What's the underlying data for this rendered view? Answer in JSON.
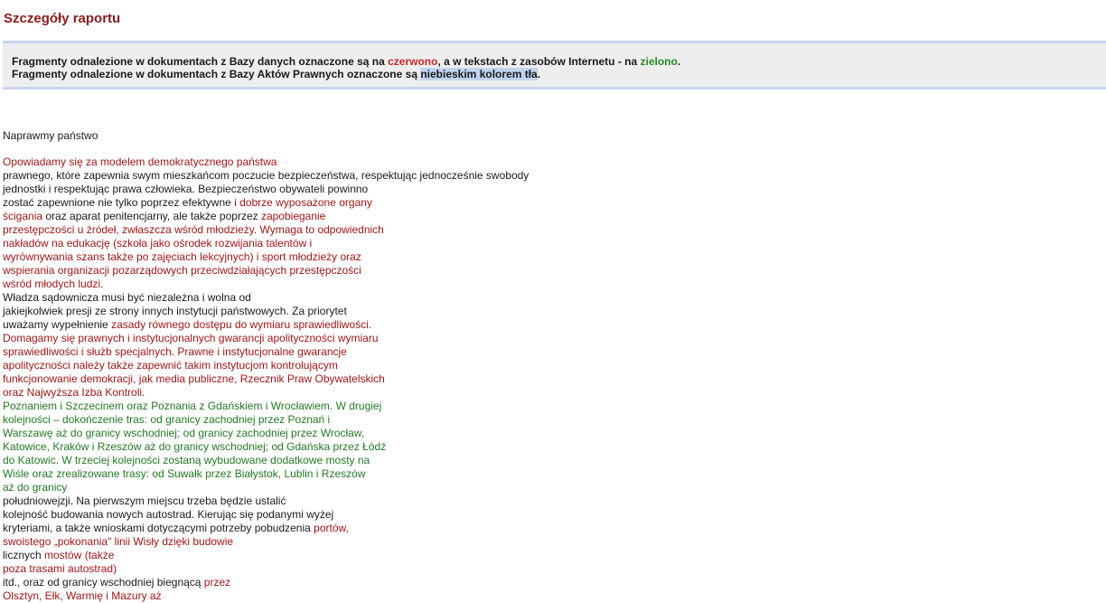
{
  "page": {
    "title": "Szczegóły raportu"
  },
  "legend": {
    "line1": {
      "pre": "Fragmenty odnalezione w dokumentach z Bazy danych oznaczone są na ",
      "red_word": "czerwono",
      "mid": ", a w tekstach z zasobów Internetu - na ",
      "green_word": "zielono",
      "post": "."
    },
    "line2": {
      "pre": "Fragmenty odnalezione w dokumentach z Bazy Aktów Prawnych oznaczone są ",
      "blue_word": "niebieskim kolorem tła",
      "post": "."
    }
  },
  "colors": {
    "title": "#8b1a1a",
    "red_match": "#a01616",
    "green_match": "#237a23",
    "blue_match_bg": "#c2d3ef",
    "legend_bg": "#eeeeee",
    "legend_border": "#c7d3f2"
  },
  "document": {
    "title": "Naprawmy państwo",
    "lines": [
      [
        {
          "t": "Opowiadamy się za modelem demokratycznego państwa",
          "c": "red"
        }
      ],
      [
        {
          "t": "prawnego, które zapewnia swym mieszkańcom poczucie bezpieczeństwa, respektując jednocześnie swobody",
          "c": "plain"
        }
      ],
      [
        {
          "t": "jednostki i respektując prawa człowieka. Bezpieczeństwo obywateli powinno",
          "c": "plain"
        }
      ],
      [
        {
          "t": "zostać zapewnione nie tylko poprzez efektywne ",
          "c": "plain"
        },
        {
          "t": "i dobrze wyposażone organy",
          "c": "red"
        }
      ],
      [
        {
          "t": "ścigania",
          "c": "red"
        },
        {
          "t": " oraz aparat penitencjarny, ale także poprzez ",
          "c": "plain"
        },
        {
          "t": "zapobieganie",
          "c": "red"
        }
      ],
      [
        {
          "t": "przestępczości u źródeł, zwłaszcza wśród młodzieży. Wymaga to odpowiednich",
          "c": "red"
        }
      ],
      [
        {
          "t": "nakładów na edukację (szkoła jako ośrodek rozwijania talentów i",
          "c": "red"
        }
      ],
      [
        {
          "t": "wyrównywania szans także po zajęciach lekcyjnych) i sport młodzieży oraz",
          "c": "red"
        }
      ],
      [
        {
          "t": "wspierania organizacji pozarządowych przeciwdziałających przestępczości",
          "c": "red"
        }
      ],
      [
        {
          "t": "wśród młodych ludzi.",
          "c": "red"
        }
      ],
      [
        {
          "t": "Władza sądownicza musi być niezależna i wolna od",
          "c": "plain"
        }
      ],
      [
        {
          "t": "jakiejkolwiek presji ze strony innych instytucji państwowych. Za priorytet",
          "c": "plain"
        }
      ],
      [
        {
          "t": "uważamy wypełnienie ",
          "c": "plain"
        },
        {
          "t": "zasady równego dostępu do wymiaru sprawiedliwości.",
          "c": "red"
        }
      ],
      [
        {
          "t": "Domagamy się prawnych i instytucjonalnych gwarancji apolityczności wymiaru",
          "c": "red"
        }
      ],
      [
        {
          "t": "sprawiedliwości i służb specjalnych. Prawne i instytucjonalne gwarancje",
          "c": "red"
        }
      ],
      [
        {
          "t": "apolityczności należy także zapewnić takim instytucjom kontrolującym",
          "c": "red"
        }
      ],
      [
        {
          "t": "funkcjonowanie demokracji, jak media publiczne, Rzecznik Praw Obywatelskich",
          "c": "red"
        }
      ],
      [
        {
          "t": "oraz Najwyższa Izba Kontroli.",
          "c": "red"
        }
      ],
      [
        {
          "t": "Poznaniem i Szczecinem oraz Poznania z Gdańskiem i Wrocławiem. W drugiej",
          "c": "green"
        }
      ],
      [
        {
          "t": "kolejności – dokończenie tras: od granicy zachodniej przez Poznań i",
          "c": "green"
        }
      ],
      [
        {
          "t": "Warszawę aż do granicy wschodniej; od granicy zachodniej przez Wrocław,",
          "c": "green"
        }
      ],
      [
        {
          "t": "Katowice, Kraków i Rzeszów aż do granicy wschodniej; od Gdańska przez Łódź",
          "c": "green"
        }
      ],
      [
        {
          "t": "do Katowic. W trzeciej kolejności zostaną wybudowane dodatkowe mosty na",
          "c": "green"
        }
      ],
      [
        {
          "t": "Wiśle oraz zrealizowane trasy: od Suwałk przez Białystok, Lublin i Rzeszów",
          "c": "green"
        }
      ],
      [
        {
          "t": "aż do granicy",
          "c": "green"
        }
      ],
      [
        {
          "t": "południowejzji. Na pierwszym miejscu trzeba będzie ustalić",
          "c": "plain"
        }
      ],
      [
        {
          "t": "kolejność budowania nowych autostrad. Kierując się podanymi wyżej",
          "c": "plain"
        }
      ],
      [
        {
          "t": "kryteriami, a także wnioskami dotyczącymi potrzeby pobudzenia ",
          "c": "plain"
        },
        {
          "t": "portów,",
          "c": "red"
        }
      ],
      [
        {
          "t": "swoistego „pokonania\" linii Wisły dzięki budowie",
          "c": "red"
        }
      ],
      [
        {
          "t": "licznych ",
          "c": "plain"
        },
        {
          "t": "mostów (także",
          "c": "red"
        }
      ],
      [
        {
          "t": "poza trasami autostrad)",
          "c": "red"
        }
      ],
      [
        {
          "t": "itd., oraz od granicy wschodniej biegnącą ",
          "c": "plain"
        },
        {
          "t": "przez",
          "c": "red"
        }
      ],
      [
        {
          "t": "Olsztyn, Ełk, Warmię i Mazury aż",
          "c": "red"
        }
      ]
    ]
  }
}
